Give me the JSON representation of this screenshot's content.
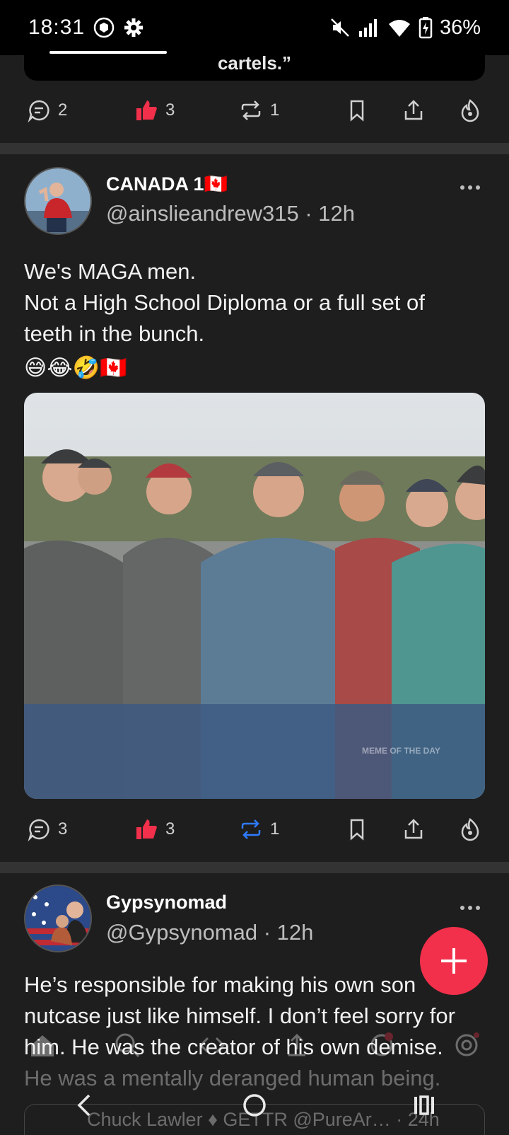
{
  "status": {
    "time": "18:31",
    "battery": "36%"
  },
  "prev_post": {
    "quote_tail": "cartels.”",
    "actions": {
      "comments": "2",
      "likes": "3",
      "reposts": "1"
    }
  },
  "posts": [
    {
      "name": "CANADA 1🇨🇦",
      "handle": "@ainslieandrew315 · 12h",
      "lines": [
        "We's MAGA  men.",
        "Not a High School Diploma or a full set of",
        "teeth in the bunch.",
        "😅😂🤣🇨🇦"
      ],
      "image_watermark": "MEME OF THE DAY",
      "actions": {
        "comments": "3",
        "likes": "3",
        "reposts": "1"
      }
    },
    {
      "name": "Gypsynomad",
      "handle": "@Gypsynomad · 12h",
      "lines": [
        "He’s responsible for making his own son",
        "nutcase just like himself. I don’t feel sorry for",
        "him. He was the creator of his own demise.",
        "He was a mentally deranged human being."
      ],
      "quoted_author": "Chuck Lawler ♦ GETTR @PureAr… · 24h"
    }
  ],
  "colors": {
    "accent_red": "#f2304b",
    "like_red": "#f2304b",
    "repost_blue": "#2f7bff"
  }
}
